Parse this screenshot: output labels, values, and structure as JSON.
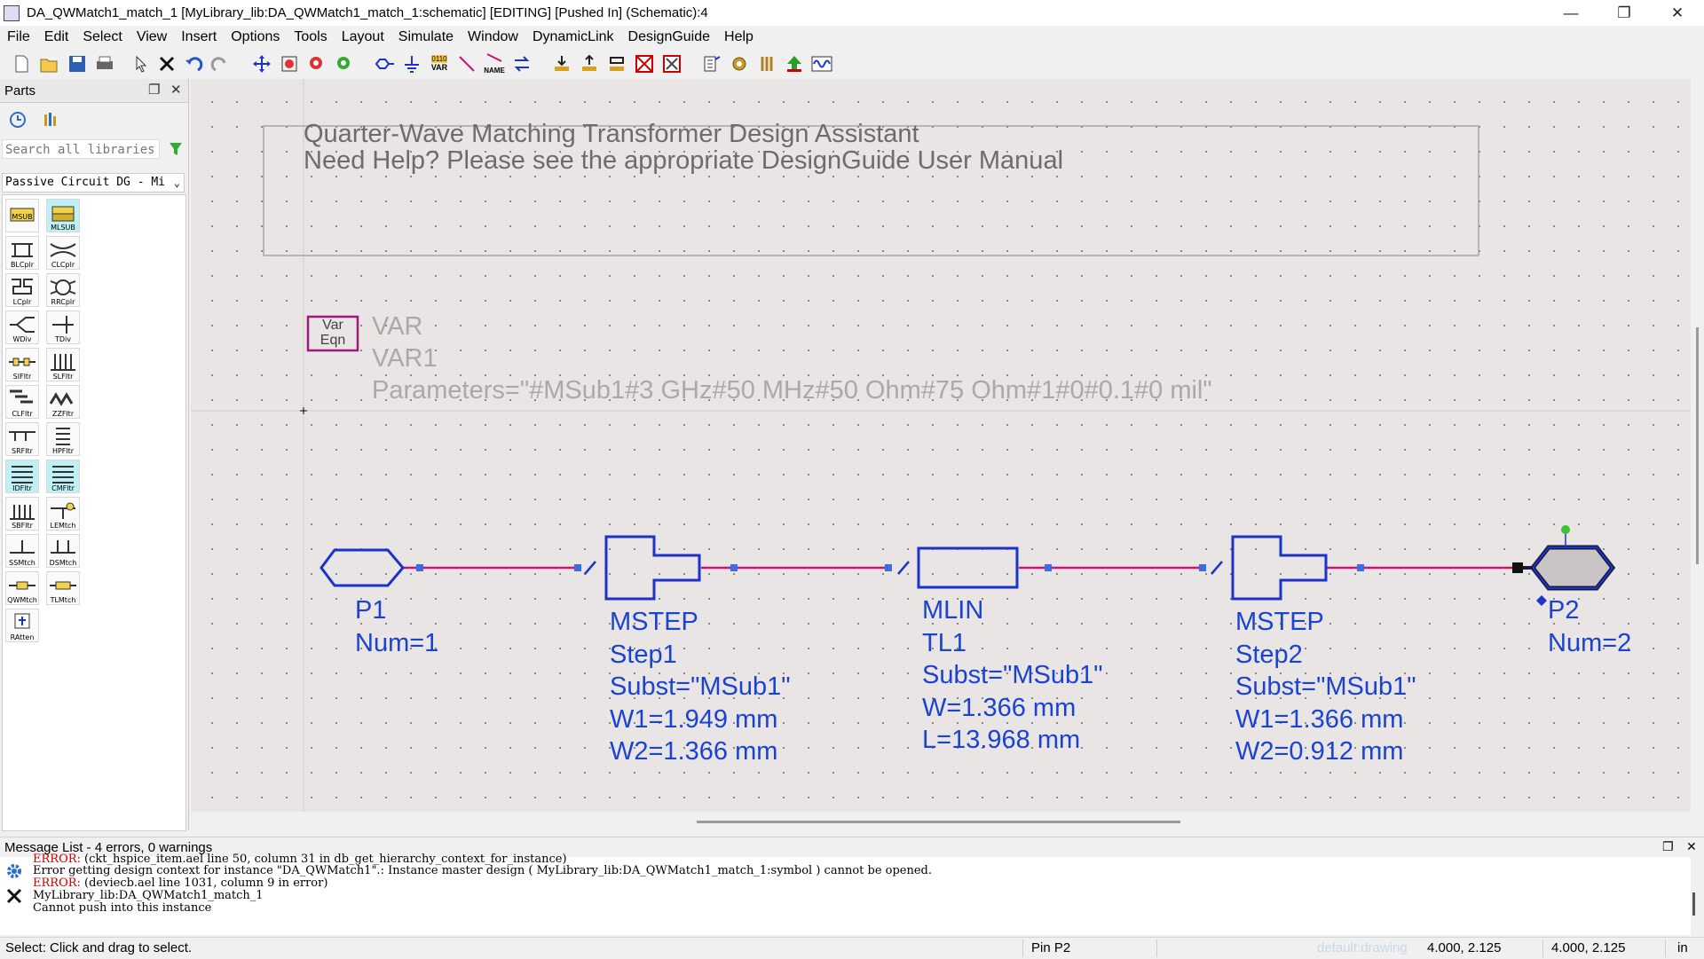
{
  "window": {
    "title": "DA_QWMatch1_match_1 [MyLibrary_lib:DA_QWMatch1_match_1:schematic] [EDITING] [Pushed In] (Schematic):4"
  },
  "window_controls": {
    "minimize": "—",
    "maximize": "❐",
    "close": "✕"
  },
  "menu": [
    "File",
    "Edit",
    "Select",
    "View",
    "Insert",
    "Options",
    "Tools",
    "Layout",
    "Simulate",
    "Window",
    "DynamicLink",
    "DesignGuide",
    "Help"
  ],
  "toolbar_icons": [
    "new-icon",
    "open-icon",
    "save-icon",
    "print-icon",
    "select-arrow-icon",
    "delete-icon",
    "undo-icon",
    "redo-icon",
    "move-icon",
    "zoom-icon",
    "zoom-out-icon",
    "zoom-in-icon",
    "port-icon",
    "ground-icon",
    "var-icon",
    "wire-icon",
    "name-icon",
    "swap-icon",
    "push-in-icon",
    "pop-out-icon",
    "pop-icon",
    "deactivate-icon",
    "short-icon",
    "netlist-icon",
    "tuning-icon",
    "probe-icon",
    "export-icon",
    "waveform-icon"
  ],
  "toolbar_labels": {
    "binary": "0110",
    "var": "VAR",
    "name": "NAME"
  },
  "parts": {
    "title": "Parts",
    "dock_icon": "❐",
    "close_icon": "✕",
    "search_placeholder": "Search all libraries",
    "library": "Passive Circuit DG - Mi",
    "items": [
      "MSUB",
      "MLSUB",
      "BLCplr",
      "CLCplr",
      "LCplr",
      "RRCplr",
      "WDiv",
      "TDiv",
      "SIFltr",
      "SLFltr",
      "CLFltr",
      "ZZFltr",
      "SRFltr",
      "HPFltr",
      "IDFltr",
      "CMFltr",
      "SBFltr",
      "LEMtch",
      "SSMtch",
      "DSMtch",
      "QWMtch",
      "TLMtch",
      "RAtten"
    ]
  },
  "schematic": {
    "banner": {
      "line1": "Quarter-Wave Matching Transformer Design Assistant",
      "line2": "Need Help?  Please see the appropriate DesignGuide User Manual"
    },
    "var_symbol": {
      "line1": "Var",
      "line2": "Eqn"
    },
    "var_block": {
      "type": "VAR",
      "name": "VAR1",
      "params": "Parameters=\"#MSub1#3 GHz#50 MHz#50 Ohm#75 Ohm#1#0#0.1#0 mil\""
    },
    "p1": {
      "name": "P1",
      "num": "Num=1"
    },
    "step1": {
      "type": "MSTEP",
      "name": "Step1",
      "subst": "Subst=\"MSub1\"",
      "w1": "W1=1.949 mm",
      "w2": "W2=1.366 mm"
    },
    "tl1": {
      "type": "MLIN",
      "name": "TL1",
      "subst": "Subst=\"MSub1\"",
      "w": "W=1.366 mm",
      "l": "L=13.968 mm"
    },
    "step2": {
      "type": "MSTEP",
      "name": "Step2",
      "subst": "Subst=\"MSub1\"",
      "w1": "W1=1.366 mm",
      "w2": "W2=0.912 mm"
    },
    "p2": {
      "name": "P2",
      "num": "Num=2"
    }
  },
  "messages": {
    "header": "Message List - 4 errors, 0 warnings",
    "dock_icon": "❐",
    "close_icon": "✕",
    "lines": [
      {
        "prefix": "ERROR:",
        "text": " (ckt_hspice_item.ael line 50, column 31 in db_get_hierarchy_context_for_instance)"
      },
      {
        "prefix": "",
        "text": "Error getting design context for instance \"DA_QWMatch1\".: Instance master design ( MyLibrary_lib:DA_QWMatch1_match_1:symbol ) cannot be opened."
      },
      {
        "prefix": "ERROR:",
        "text": " (deviecb.ael line 1031, column 9 in error)"
      },
      {
        "prefix": "",
        "text": "MyLibrary_lib:DA_QWMatch1_match_1"
      },
      {
        "prefix": "",
        "text": "Cannot push into this instance"
      }
    ]
  },
  "status": {
    "hint": "Select: Click and drag to select.",
    "pin": "Pin P2",
    "layer": "default:drawing",
    "coord1": "4.000, 2.125",
    "coord2": "4.000, 2.125",
    "unit": "in"
  },
  "colors": {
    "wire": "#cc1177",
    "component": "#1a33c8",
    "comp_text": "#1a43d0",
    "error": "#cc0000",
    "canvas": "#e9e5e4"
  }
}
